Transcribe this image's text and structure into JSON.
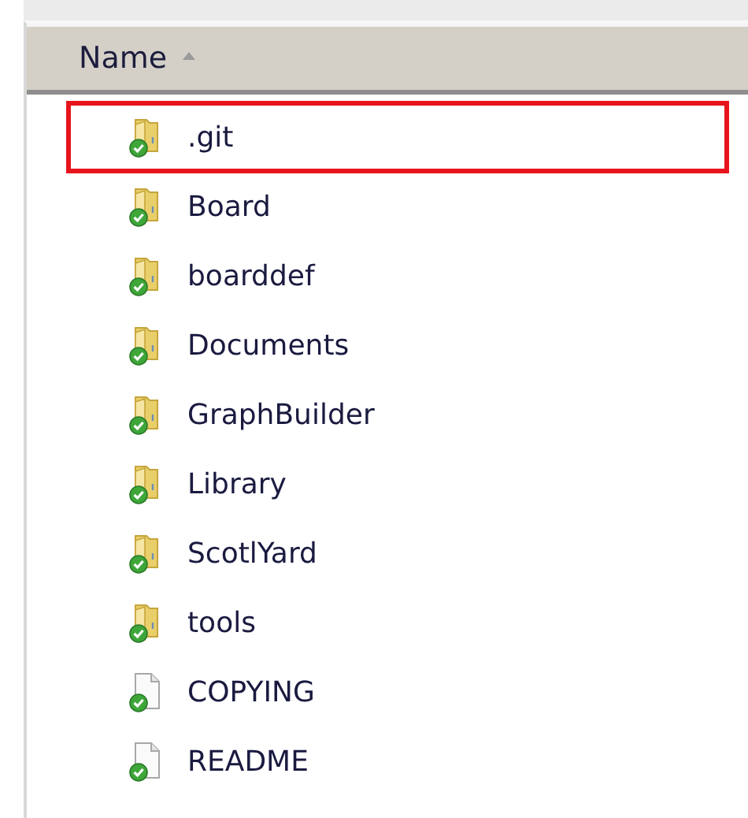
{
  "column": {
    "label": "Name",
    "sort_ascending": true
  },
  "items": [
    {
      "name": ".git",
      "kind": "folder",
      "outlined": true
    },
    {
      "name": "Board",
      "kind": "folder",
      "outlined": false
    },
    {
      "name": "boarddef",
      "kind": "folder",
      "outlined": false
    },
    {
      "name": "Documents",
      "kind": "folder",
      "outlined": false
    },
    {
      "name": "GraphBuilder",
      "kind": "folder",
      "outlined": false
    },
    {
      "name": "Library",
      "kind": "folder",
      "outlined": false
    },
    {
      "name": "ScotlYard",
      "kind": "folder",
      "outlined": false
    },
    {
      "name": "tools",
      "kind": "folder",
      "outlined": false
    },
    {
      "name": "COPYING",
      "kind": "file",
      "outlined": false
    },
    {
      "name": "README",
      "kind": "file",
      "outlined": false
    }
  ]
}
